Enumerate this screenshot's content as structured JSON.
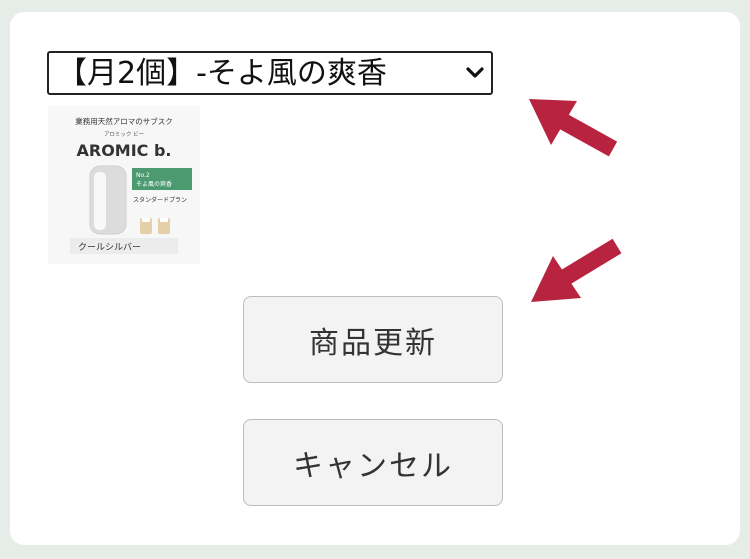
{
  "product_select": {
    "selected": "【月2個】-そよ風の爽香",
    "icon": "chevron-down-icon"
  },
  "product_image": {
    "top_text": "業務用天然アロマのサブスク",
    "sub_text": "アロミック ビー",
    "brand": "AROMIC b.",
    "tag_line1": "No.2",
    "tag_line2": "そよ風の爽香",
    "plan": "スタンダードプラン",
    "color_label": "クールシルバー"
  },
  "buttons": {
    "update_label": "商品更新",
    "cancel_label": "キャンセル"
  },
  "colors": {
    "accent_arrow": "#b8243f",
    "background": "#e6ede9",
    "tag_green": "#4b9a70"
  }
}
